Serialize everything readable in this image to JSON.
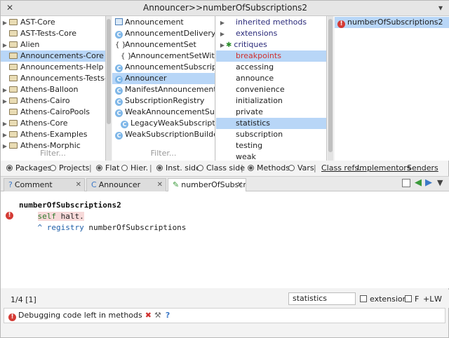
{
  "window": {
    "title": "Announcer>>numberOfSubscriptions2",
    "close_glyph": "✕",
    "menu_glyph": "▾"
  },
  "packages": {
    "items": [
      {
        "label": "AST-Core",
        "expandable": true,
        "selected": false
      },
      {
        "label": "AST-Tests-Core",
        "expandable": false,
        "selected": false
      },
      {
        "label": "Alien",
        "expandable": true,
        "selected": false
      },
      {
        "label": "Announcements-Core",
        "expandable": false,
        "selected": true
      },
      {
        "label": "Announcements-Help",
        "expandable": false,
        "selected": false
      },
      {
        "label": "Announcements-Tests-Cor",
        "expandable": false,
        "selected": false
      },
      {
        "label": "Athens-Balloon",
        "expandable": true,
        "selected": false
      },
      {
        "label": "Athens-Cairo",
        "expandable": true,
        "selected": false
      },
      {
        "label": "Athens-CairoPools",
        "expandable": false,
        "selected": false
      },
      {
        "label": "Athens-Core",
        "expandable": true,
        "selected": false
      },
      {
        "label": "Athens-Examples",
        "expandable": true,
        "selected": false
      },
      {
        "label": "Athens-Morphic",
        "expandable": true,
        "selected": false
      }
    ],
    "filter_placeholder": "Filter..."
  },
  "classes": {
    "items": [
      {
        "label": "Announcement",
        "icon": "comment-icon",
        "selected": false,
        "indent": false
      },
      {
        "label": "AnnouncementDeliveryCondi",
        "icon": "class-icon",
        "selected": false,
        "indent": false
      },
      {
        "label": "AnnouncementSet",
        "icon": "trait-icon",
        "selected": false,
        "indent": false
      },
      {
        "label": "AnnouncementSetWithExcl",
        "icon": "trait-icon",
        "selected": false,
        "indent": true
      },
      {
        "label": "AnnouncementSubscription",
        "icon": "class-icon",
        "selected": false,
        "indent": false
      },
      {
        "label": "Announcer",
        "icon": "class-icon",
        "selected": true,
        "indent": false
      },
      {
        "label": "ManifestAnnouncementsCore",
        "icon": "class-icon",
        "selected": false,
        "indent": false
      },
      {
        "label": "SubscriptionRegistry",
        "icon": "class-icon",
        "selected": false,
        "indent": false
      },
      {
        "label": "WeakAnnouncementSubscrip",
        "icon": "class-icon",
        "selected": false,
        "indent": false
      },
      {
        "label": "LegacyWeakSubscription",
        "icon": "class-icon",
        "selected": false,
        "indent": true
      },
      {
        "label": "WeakSubscriptionBuilder",
        "icon": "class-icon",
        "selected": false,
        "indent": false
      }
    ],
    "filter_placeholder": "Filter..."
  },
  "protocols": {
    "items": [
      {
        "label": "inherited methods",
        "style": "navy",
        "expandable": true,
        "icon": ""
      },
      {
        "label": "extensions",
        "style": "navy",
        "expandable": true,
        "icon": ""
      },
      {
        "label": "critiques",
        "style": "navy",
        "expandable": true,
        "icon": "bug-icon"
      },
      {
        "label": "breakpoints",
        "style": "red-selected",
        "expandable": false,
        "icon": ""
      },
      {
        "label": "accessing",
        "style": "plain",
        "expandable": false,
        "icon": ""
      },
      {
        "label": "announce",
        "style": "plain",
        "expandable": false,
        "icon": ""
      },
      {
        "label": "convenience",
        "style": "plain",
        "expandable": false,
        "icon": ""
      },
      {
        "label": "initialization",
        "style": "plain",
        "expandable": false,
        "icon": ""
      },
      {
        "label": "private",
        "style": "plain",
        "expandable": false,
        "icon": ""
      },
      {
        "label": "statistics",
        "style": "highlight",
        "expandable": false,
        "icon": ""
      },
      {
        "label": "subscription",
        "style": "plain",
        "expandable": false,
        "icon": ""
      },
      {
        "label": "testing",
        "style": "plain",
        "expandable": false,
        "icon": ""
      },
      {
        "label": "weak",
        "style": "plain",
        "expandable": false,
        "icon": ""
      }
    ]
  },
  "methods": {
    "items": [
      {
        "label": "numberOfSubscriptions2",
        "selected": true
      }
    ]
  },
  "toolbar": {
    "packages": "Packages",
    "projects": "Projects",
    "flat": "Flat",
    "hier": "Hier.",
    "inst_side": "Inst. side",
    "class_side": "Class side",
    "methods": "Methods",
    "vars": "Vars",
    "class_refs": "Class refs.",
    "implementors": "Implementors",
    "senders": "Senders",
    "separator": "|"
  },
  "tabs": [
    {
      "label": "Comment",
      "icon": "?",
      "active": false
    },
    {
      "label": "Announcer",
      "icon": "C",
      "active": false
    },
    {
      "label": "numberOfSubscri",
      "icon": "✎",
      "active": true
    }
  ],
  "tab_close": "✕",
  "editor": {
    "line1": "numberOfSubscriptions2",
    "line2_kw": "self",
    "line2_rest": " halt.",
    "line3_caret": "^",
    "line3_var": "registry",
    "line3_rest": " numberOfSubscriptions",
    "error_marker": "!"
  },
  "status": {
    "position": "1/4 [1]",
    "protocol_value": "statistics",
    "extension_label": "extension",
    "f_label": "F",
    "l_label": "+L",
    "w_label": "W"
  },
  "critic": {
    "message": "Debugging code left in methods",
    "marker": "!",
    "fix_glyph": "✖",
    "tool_glyph": "⚒",
    "help_glyph": "?"
  }
}
